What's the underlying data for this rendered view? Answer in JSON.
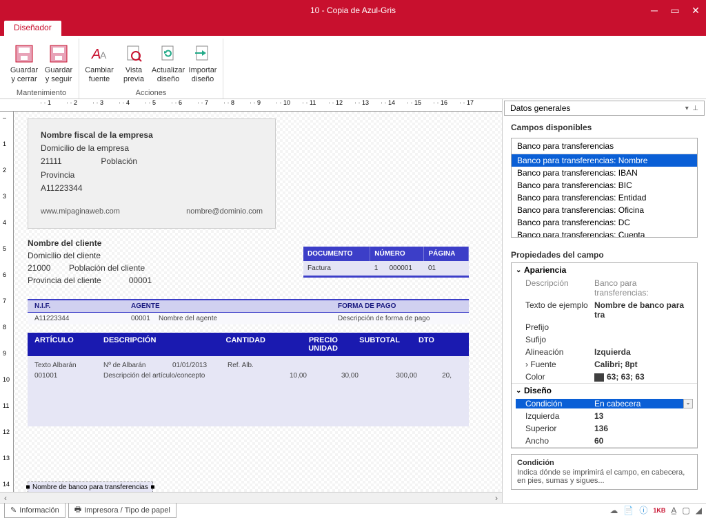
{
  "window": {
    "title": "10 - Copia de Azul-Gris"
  },
  "tab": "Diseñador",
  "ribbon": {
    "groups": [
      {
        "name": "Mantenimiento",
        "items": [
          {
            "label": "Guardar y cerrar",
            "icon": "save-close"
          },
          {
            "label": "Guardar y seguir",
            "icon": "save"
          }
        ]
      },
      {
        "name": "Acciones",
        "items": [
          {
            "label": "Cambiar fuente",
            "icon": "font"
          },
          {
            "label": "Vista previa",
            "icon": "preview"
          },
          {
            "label": "Actualizar diseño",
            "icon": "refresh"
          },
          {
            "label": "Importar diseño",
            "icon": "import"
          }
        ]
      }
    ]
  },
  "company": {
    "name": "Nombre fiscal de la empresa",
    "address": "Domicilio de la empresa",
    "postal": "21111",
    "city": "Población",
    "province": "Provincia",
    "nif": "A11223344",
    "web": "www.mipaginaweb.com",
    "email": "nombre@dominio.com"
  },
  "client": {
    "name": "Nombre del cliente",
    "address": "Domicilio del cliente",
    "postal": "21000",
    "city": "Población del cliente",
    "province": "Provincia del cliente",
    "code": "00001"
  },
  "doc_header": {
    "cols": [
      "DOCUMENTO",
      "NÚMERO",
      "PÁGINA"
    ],
    "vals": [
      "Factura",
      "1",
      "000001",
      "01"
    ]
  },
  "nif_bar": {
    "heads": [
      "N.I.F.",
      "AGENTE",
      "FORMA DE PAGO"
    ],
    "vals": [
      "A11223344",
      "00001",
      "Nombre del agente",
      "Descripción de forma de pago"
    ]
  },
  "items": {
    "heads": [
      "ARTÍCULO",
      "DESCRIPCIÓN",
      "CANTIDAD",
      "PRECIO UNIDAD",
      "SUBTOTAL",
      "DTO"
    ],
    "row1": [
      "Texto Albarán",
      "Nº de Albarán",
      "01/01/2013",
      "Ref. Alb."
    ],
    "row2": [
      "001001",
      "Descripción del artículo/concepto",
      "10,00",
      "30,00",
      "300,00",
      "20,"
    ]
  },
  "selected_field": "Nombre de banco para transferencias",
  "right": {
    "dropdown": "Datos generales",
    "campos_title": "Campos disponibles",
    "group_name": "Banco para transferencias",
    "fields": [
      "Banco para transferencias: Nombre",
      "Banco para transferencias: IBAN",
      "Banco para transferencias: BIC",
      "Banco para transferencias: Entidad",
      "Banco para transferencias: Oficina",
      "Banco para transferencias: DC",
      "Banco para transferencias: Cuenta"
    ],
    "props_title": "Propiedades del campo",
    "apariencia": "Apariencia",
    "diseno": "Diseño",
    "props": {
      "descripcion_k": "Descripción",
      "descripcion_v": "Banco para transferencias:",
      "texto_k": "Texto de ejemplo",
      "texto_v": "Nombre de banco para tra",
      "prefijo_k": "Prefijo",
      "prefijo_v": "",
      "sufijo_k": "Sufijo",
      "sufijo_v": "",
      "alin_k": "Alineación",
      "alin_v": "Izquierda",
      "fuente_k": "Fuente",
      "fuente_v": "Calibri; 8pt",
      "color_k": "Color",
      "color_v": "63; 63; 63",
      "cond_k": "Condición",
      "cond_v": "En cabecera",
      "izq_k": "Izquierda",
      "izq_v": "13",
      "sup_k": "Superior",
      "sup_v": "136",
      "ancho_k": "Ancho",
      "ancho_v": "60"
    },
    "help": {
      "title": "Condición",
      "text": "Indica dónde se imprimirá el campo, en cabecera, en pies, sumas y sigues..."
    }
  },
  "status": {
    "info": "Información",
    "printer": "Impresora / Tipo de papel"
  }
}
